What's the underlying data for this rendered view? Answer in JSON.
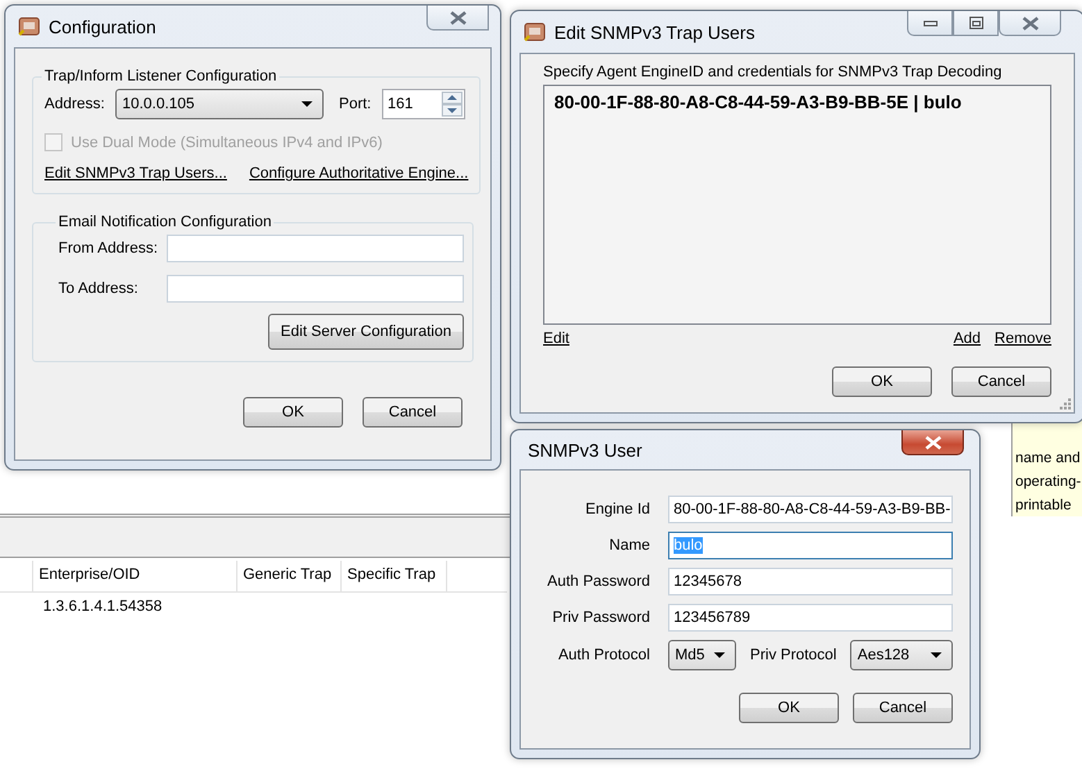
{
  "background_app": {
    "table": {
      "columns": [
        "Enterprise/OID",
        "Generic Trap",
        "Specific Trap"
      ],
      "rows": [
        {
          "enterprise_oid": "1.3.6.1.4.1.54358"
        }
      ]
    },
    "description_panel": {
      "lines": [
        "name and",
        "operating-",
        "printable"
      ]
    }
  },
  "configuration_window": {
    "title": "Configuration",
    "listener_group": {
      "title": "Trap/Inform Listener Configuration",
      "address_label": "Address:",
      "address_value": "10.0.0.105",
      "port_label": "Port:",
      "port_value": "161",
      "dual_mode": {
        "label": "Use Dual Mode (Simultaneous IPv4 and IPv6)",
        "checked": false,
        "disabled": true
      },
      "links": [
        "Edit SNMPv3 Trap Users...",
        "Configure Authoritative Engine..."
      ]
    },
    "email_group": {
      "title": "Email Notification Configuration",
      "fields": [
        {
          "label": "From Address:"
        },
        {
          "label": "To Address:"
        }
      ],
      "button": "Edit Server Configuration"
    },
    "buttons": [
      "OK",
      "Cancel"
    ]
  },
  "trap_users_window": {
    "title": "Edit SNMPv3 Trap Users",
    "instruction": "Specify Agent EngineID and credentials for SNMPv3 Trap Decoding",
    "users": [
      {
        "text": "80-00-1F-88-80-A8-C8-44-59-A3-B9-BB-5E | bulo",
        "selected": false
      }
    ],
    "left_links": [
      "Edit"
    ],
    "right_links": [
      "Add",
      "Remove"
    ],
    "buttons": [
      "OK",
      "Cancel"
    ]
  },
  "user_window": {
    "title": "SNMPv3 User",
    "fields": [
      {
        "label": "Engine Id",
        "value": "80-00-1F-88-80-A8-C8-44-59-A3-B9-BB-",
        "focused": false
      },
      {
        "label": "Name",
        "value": "bulo",
        "focused": true
      },
      {
        "label": "Auth Password",
        "value": "12345678",
        "focused": false
      },
      {
        "label": "Priv Password",
        "value": "123456789",
        "focused": false
      }
    ],
    "auth_protocol_label": "Auth Protocol",
    "auth_protocol": "Md5",
    "priv_protocol_label": "Priv Protocol",
    "priv_protocol": "Aes128",
    "buttons": [
      "OK",
      "Cancel"
    ]
  }
}
